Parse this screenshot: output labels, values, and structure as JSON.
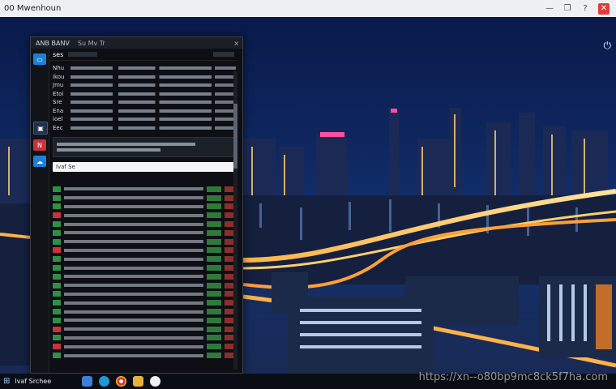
{
  "window": {
    "title": "00 Mwenhoun",
    "controls": {
      "minimize": "—",
      "restore": "❐",
      "help": "?",
      "close": "✕"
    }
  },
  "app": {
    "title": "ANB BANV",
    "crumb": "Su  Mv Tr",
    "close": "×",
    "tab_label": "ses",
    "search_placeholder": "lvaf Se",
    "top_keys": [
      "Nhu",
      "ikou",
      "Jmu",
      "Etoi",
      "Sre",
      "Ena",
      "ioel",
      "Eec"
    ]
  },
  "taskbar": {
    "start_glyph": "⊞",
    "search_label": "lvaf Srchee"
  },
  "watermark": "https://xn--o80bp9mc8ck5f7ha.com",
  "icons": {
    "corner": "power-icon",
    "sidebar": [
      "browser-icon",
      "monitor-icon",
      "news-icon",
      "cloud-icon"
    ]
  },
  "colors": {
    "accent": "#1f7fd6",
    "danger": "#c9323a",
    "positive": "#2f7a3b"
  }
}
